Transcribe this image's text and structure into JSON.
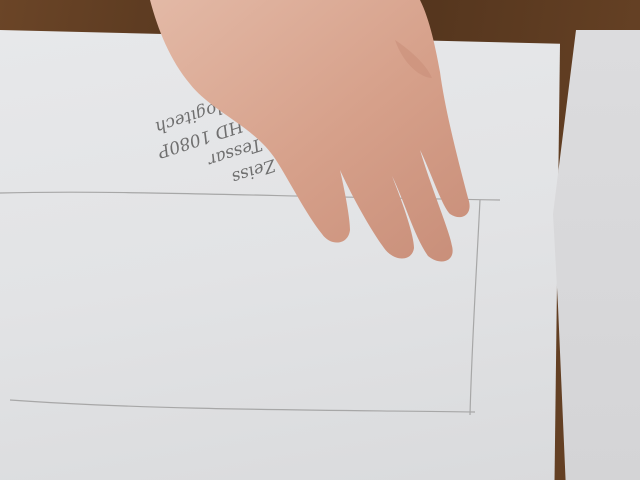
{
  "photo": {
    "handwriting_lines": [
      "Zeiss",
      "Tessar",
      "HD 1080P",
      "logitech"
    ],
    "colors": {
      "table": "#5a3a22",
      "paper": "#e3e4e6",
      "skin": "#d9a58e",
      "pencil": "#9e9e9e"
    }
  }
}
